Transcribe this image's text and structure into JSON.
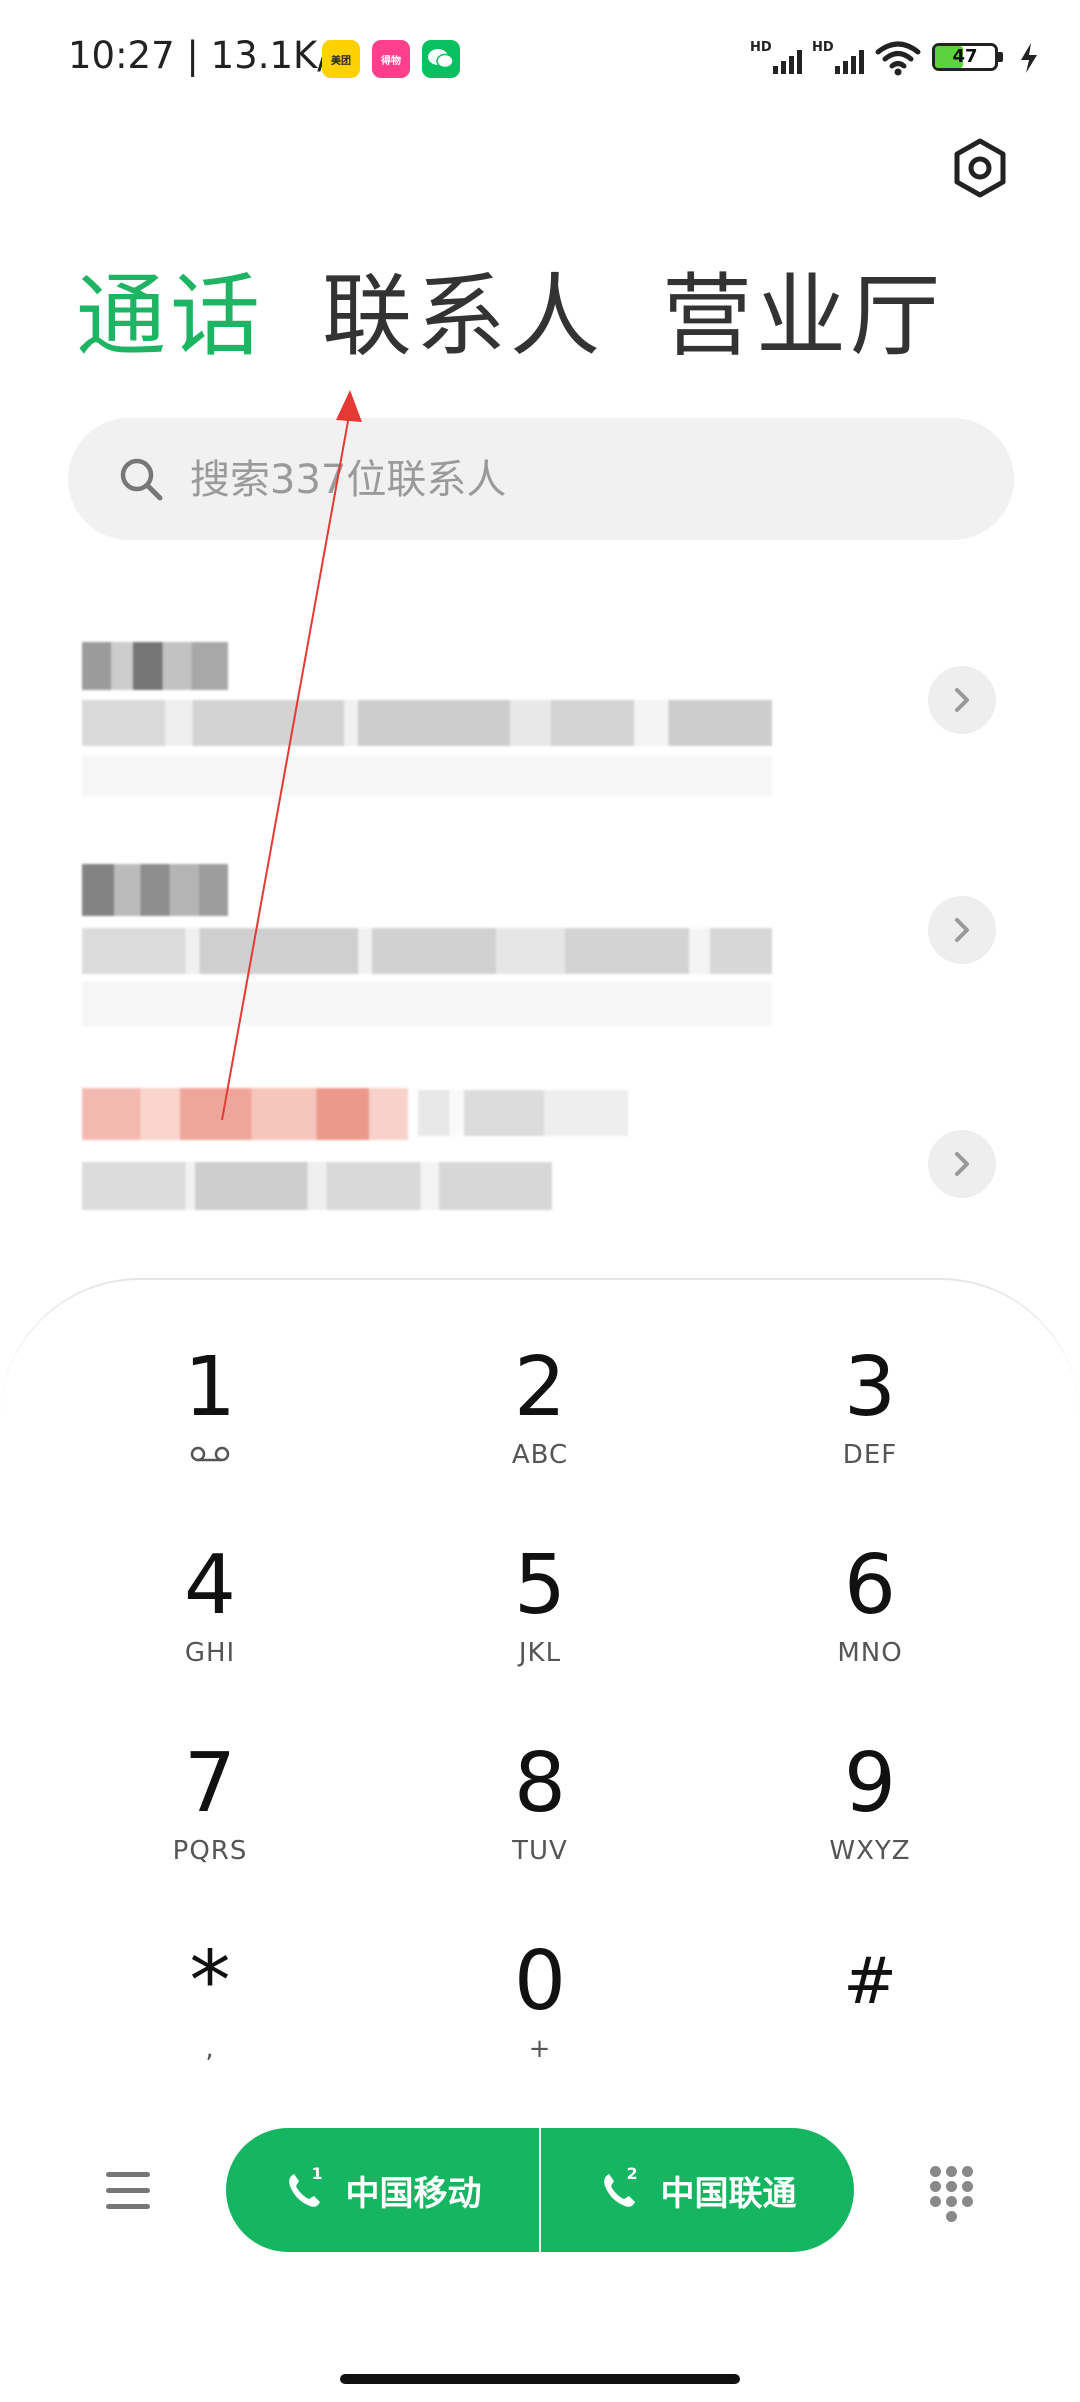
{
  "status_bar": {
    "time": "10:27 | 13.1K/s",
    "apps": [
      "美团",
      "得物",
      "微信"
    ],
    "sim1_label": "HD",
    "sim2_label": "HD",
    "battery": "47"
  },
  "tabs": [
    {
      "label": "通话",
      "active": true
    },
    {
      "label": "联系人",
      "active": false
    },
    {
      "label": "营业厅",
      "active": false
    }
  ],
  "search": {
    "placeholder": "搜索337位联系人"
  },
  "call_log": {
    "items": [
      {
        "name": "",
        "detail": ""
      },
      {
        "name": "",
        "detail": ""
      },
      {
        "name": "",
        "detail": ""
      }
    ]
  },
  "keypad": {
    "keys": [
      {
        "digit": "1",
        "letters": ""
      },
      {
        "digit": "2",
        "letters": "ABC"
      },
      {
        "digit": "3",
        "letters": "DEF"
      },
      {
        "digit": "4",
        "letters": "GHI"
      },
      {
        "digit": "5",
        "letters": "JKL"
      },
      {
        "digit": "6",
        "letters": "MNO"
      },
      {
        "digit": "7",
        "letters": "PQRS"
      },
      {
        "digit": "8",
        "letters": "TUV"
      },
      {
        "digit": "9",
        "letters": "WXYZ"
      },
      {
        "digit": "*",
        "letters": ","
      },
      {
        "digit": "0",
        "letters": "+"
      },
      {
        "digit": "#",
        "letters": ""
      }
    ]
  },
  "bottom_bar": {
    "sim1": {
      "label": "中国移动",
      "index": "1"
    },
    "sim2": {
      "label": "中国联通",
      "index": "2"
    }
  },
  "colors": {
    "accent": "#1db563",
    "call_button": "#16b561",
    "annotation": "#e53935"
  },
  "icons": [
    "settings-icon",
    "search-icon",
    "chevron-right-icon",
    "voicemail-icon",
    "menu-icon",
    "phone-icon",
    "dialpad-icon"
  ]
}
